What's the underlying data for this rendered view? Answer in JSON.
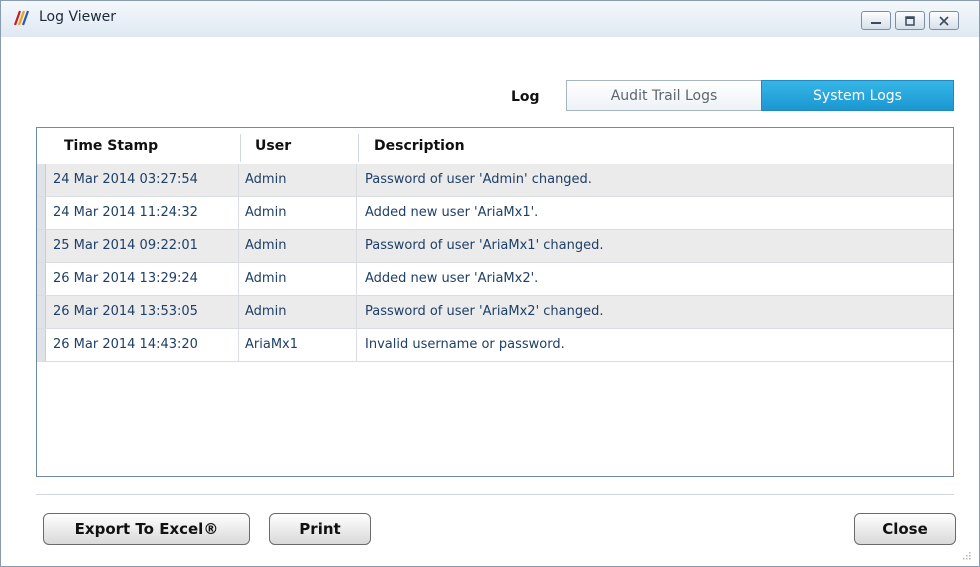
{
  "window": {
    "title": "Log Viewer"
  },
  "tabs": {
    "label": "Log",
    "audit": "Audit Trail Logs",
    "system": "System Logs",
    "active": "System Logs"
  },
  "grid": {
    "columns": [
      "Time Stamp",
      "User",
      "Description"
    ],
    "rows": [
      {
        "timestamp": "24 Mar 2014  03:27:54",
        "user": "Admin",
        "description": "Password of user 'Admin' changed."
      },
      {
        "timestamp": "24 Mar 2014  11:24:32",
        "user": "Admin",
        "description": "Added new user 'AriaMx1'."
      },
      {
        "timestamp": "25 Mar 2014  09:22:01",
        "user": "Admin",
        "description": "Password of user 'AriaMx1' changed."
      },
      {
        "timestamp": "26 Mar 2014  13:29:24",
        "user": "Admin",
        "description": "Added new user 'AriaMx2'."
      },
      {
        "timestamp": "26 Mar 2014  13:53:05",
        "user": "Admin",
        "description": "Password of user 'AriaMx2' changed."
      },
      {
        "timestamp": "26 Mar 2014  14:43:20",
        "user": "AriaMx1",
        "description": "Invalid username or password."
      }
    ]
  },
  "buttons": {
    "export": "Export To Excel®",
    "print": "Print",
    "close": "Close"
  },
  "colors": {
    "active_tab": "#1c97d2",
    "text_blue": "#1e3f66",
    "odd_row": "#ebebeb"
  },
  "icons": {
    "app": "log-viewer-app-icon",
    "minimize": "minimize-icon",
    "maximize": "maximize-icon",
    "close": "close-icon",
    "grip": "resize-grip-icon"
  }
}
